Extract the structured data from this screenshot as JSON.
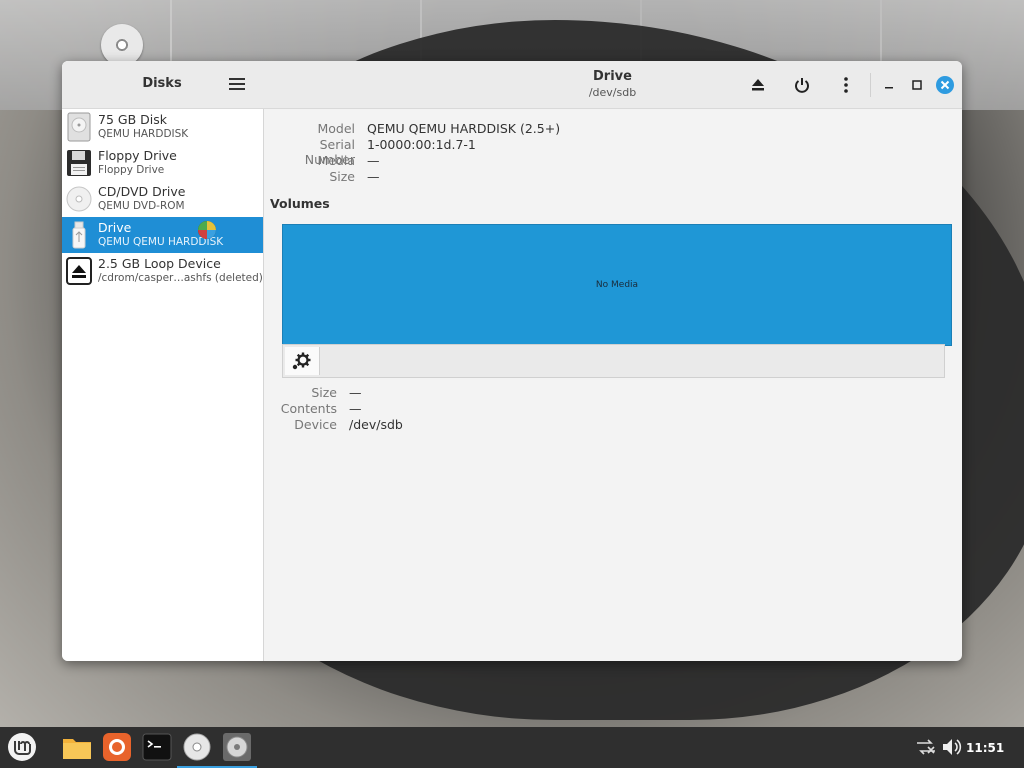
{
  "sidebar": {
    "title": "Disks",
    "devices": [
      {
        "name": "75 GB Disk",
        "sub": "QEMU HARDDISK",
        "icon": "hard-disk-icon"
      },
      {
        "name": "Floppy Drive",
        "sub": "Floppy Drive",
        "icon": "floppy-icon"
      },
      {
        "name": "CD/DVD Drive",
        "sub": "QEMU DVD-ROM",
        "icon": "optical-disc-icon"
      },
      {
        "name": "Drive",
        "sub": "QEMU QEMU HARDDISK",
        "icon": "usb-drive-icon",
        "selected": true
      },
      {
        "name": "2.5 GB Loop Device",
        "sub": "/cdrom/casper…ashfs (deleted)",
        "icon": "eject-icon"
      }
    ]
  },
  "header": {
    "title": "Drive",
    "subtitle": "/dev/sdb"
  },
  "drive_info": {
    "model_label": "Model",
    "model_value": "QEMU QEMU HARDDISK (2.5+)",
    "serial_label": "Serial Number",
    "serial_value": "1-0000:00:1d.7-1",
    "media_label": "Media",
    "media_value": "—",
    "size_label": "Size",
    "size_value": "—"
  },
  "volumes": {
    "title": "Volumes",
    "map_text": "No Media"
  },
  "volume_info": {
    "size_label": "Size",
    "size_value": "—",
    "contents_label": "Contents",
    "contents_value": "—",
    "device_label": "Device",
    "device_value": "/dev/sdb"
  },
  "taskbar": {
    "clock": "11:51"
  },
  "colors": {
    "accent": "#1f8ed5",
    "volume_fill": "#1f97d6",
    "close_button": "#2e9be0",
    "taskbar": "#2f2f2f"
  }
}
